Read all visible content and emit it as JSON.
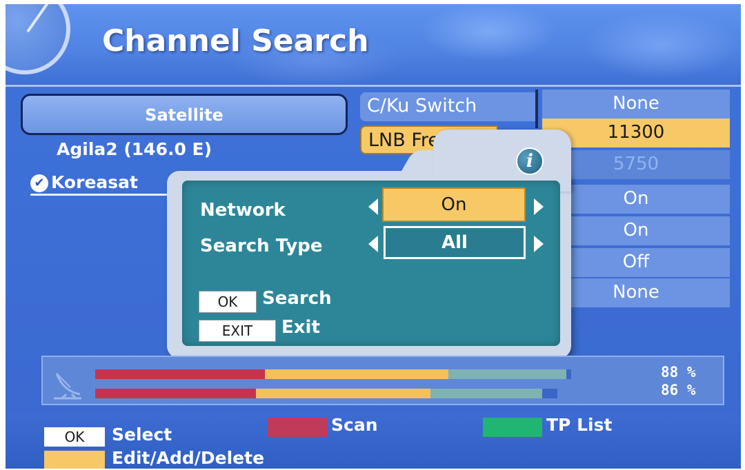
{
  "header": {
    "title": "Channel Search"
  },
  "satellite_list": {
    "header": "Satellite",
    "items": [
      {
        "name": "Agila2 (146.0 E)",
        "selected": false
      },
      {
        "name": "Koreasat",
        "selected": true
      }
    ]
  },
  "settings_table": {
    "labels": [
      "C/Ku Switch",
      "LNB Fre"
    ],
    "values": [
      "None",
      "11300",
      "5750",
      "On",
      "On",
      "Off",
      "None"
    ]
  },
  "popup": {
    "info_icon": "info-icon",
    "network_label": "Network",
    "network_value": "On",
    "search_type_label": "Search Type",
    "search_type_value": "All",
    "ok_key": "OK",
    "ok_action": "Search",
    "exit_key": "EXIT",
    "exit_action": "Exit"
  },
  "signal": {
    "strength_label": "88 %",
    "quality_label": "86 %",
    "strength": 0.88,
    "quality": 0.86
  },
  "footer": {
    "ok_key": "OK",
    "select_label": "Select",
    "scan_label": "Scan",
    "tp_list_label": "TP List",
    "edit_label": "Edit/Add/Delete"
  },
  "colors": {
    "background": "#3d6fd6",
    "highlight": "#f6c866",
    "popup": "#2d8698",
    "red_key": "#c03a5a",
    "green_key": "#21b574",
    "yellow_key": "#f6c866"
  }
}
